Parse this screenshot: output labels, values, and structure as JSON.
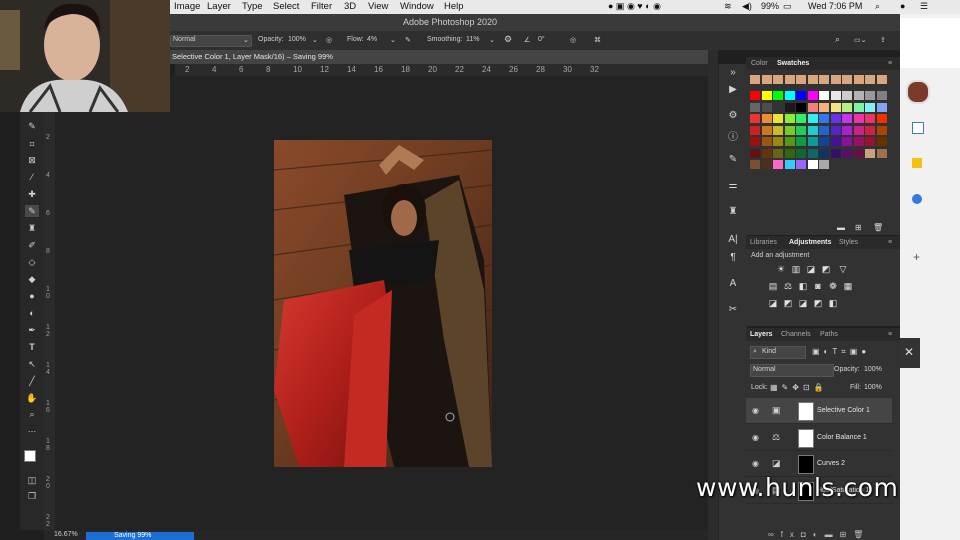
{
  "menubar": {
    "items": [
      "Image",
      "Layer",
      "Type",
      "Select",
      "Filter",
      "3D",
      "View",
      "Window",
      "Help"
    ],
    "battery": "99%",
    "clock": "Wed 7:06 PM"
  },
  "window": {
    "title": "Adobe Photoshop 2020"
  },
  "options": {
    "mode": "Normal",
    "opacity_label": "Opacity:",
    "opacity": "100%",
    "flow_label": "Flow:",
    "flow": "4%",
    "smoothing_label": "Smoothing:",
    "smoothing": "11%",
    "angle": "0°"
  },
  "document": {
    "tab_title": "Selective Color 1, Layer Mask/16) – Saving 99%",
    "zoom": "16.67%",
    "status": "Saving 99%"
  },
  "ruler": {
    "h_labels": [
      "2",
      "4",
      "6",
      "8",
      "10",
      "12",
      "14",
      "16",
      "18",
      "20",
      "22",
      "24",
      "26",
      "28",
      "30",
      "32"
    ],
    "v_labels": [
      "0",
      "2",
      "4",
      "6",
      "8",
      "1\n0",
      "1\n2",
      "1\n4",
      "1\n6",
      "1\n8",
      "2\n0",
      "2\n2"
    ]
  },
  "panels": {
    "color_tabs": [
      "Color",
      "Swatches"
    ],
    "mid_tabs": [
      "Libraries",
      "Adjustments",
      "Styles"
    ],
    "add_adjustment": "Add an adjustment",
    "layer_tabs": [
      "Layers",
      "Channels",
      "Paths"
    ],
    "kind": "Kind",
    "blend_mode": "Normal",
    "opacity_label": "Opacity:",
    "opacity": "100%",
    "lock_label": "Lock:",
    "fill_label": "Fill:",
    "fill": "100%"
  },
  "layers": [
    {
      "name": "Selective Color 1",
      "selected": true,
      "icon": "selective-color-icon",
      "mask": "white"
    },
    {
      "name": "Color Balance 1",
      "selected": false,
      "icon": "color-balance-icon",
      "mask": "white"
    },
    {
      "name": "Curves 2",
      "selected": false,
      "icon": "curves-icon",
      "mask": "black"
    },
    {
      "name": "Hue/Saturation 1",
      "selected": false,
      "icon": "hue-saturation-icon",
      "mask": "black"
    }
  ],
  "watermark": "www.hunls.com",
  "swatches": {
    "row1": [
      "#d9a77e",
      "#d9a77e",
      "#d9a77e",
      "#d9a77e",
      "#d9a77e",
      "#d9a77e",
      "#d9a77e",
      "#d9a77e",
      "#d9a77e",
      "#d9a77e",
      "#d9a77e",
      "#d9a77e"
    ],
    "grid": [
      [
        "#ff0000",
        "#ffff00",
        "#00ff00",
        "#00ffff",
        "#0000ff",
        "#ff00ff",
        "#ffffff",
        "#e6e6e6",
        "#cccccc",
        "#b3b3b3",
        "#999999",
        "#808080"
      ],
      [
        "#666666",
        "#4d4d4d",
        "#333333",
        "#1a1a1a",
        "#000000",
        "#f28080",
        "#f2b380",
        "#f2e680",
        "#b3f280",
        "#80f2a6",
        "#80f2f2",
        "#80a6f2"
      ],
      [
        "#ee3333",
        "#ef8c33",
        "#eee333",
        "#8cee33",
        "#33ee66",
        "#33eeee",
        "#3377ee",
        "#6633ee",
        "#cc33ee",
        "#ee33aa",
        "#ee3366",
        "#ee3300"
      ],
      [
        "#cc2222",
        "#cc7722",
        "#ccbb22",
        "#77cc22",
        "#22cc55",
        "#22cccc",
        "#2266cc",
        "#5522cc",
        "#aa22cc",
        "#cc2288",
        "#cc2244",
        "#aa4400"
      ],
      [
        "#991111",
        "#995511",
        "#998811",
        "#559911",
        "#119944",
        "#119999",
        "#114499",
        "#441199",
        "#881199",
        "#991166",
        "#991133",
        "#663300"
      ],
      [
        "#661111",
        "#663311",
        "#666611",
        "#336611",
        "#116633",
        "#116666",
        "#113366",
        "#331166",
        "#551166",
        "#661144",
        "#c8a27a",
        "#a07050"
      ],
      [
        "#7a5030",
        "#4a3020",
        "#ff66cc",
        "#33ccff",
        "#9966ff",
        "#ffffff",
        "#aaaaaa"
      ]
    ]
  }
}
